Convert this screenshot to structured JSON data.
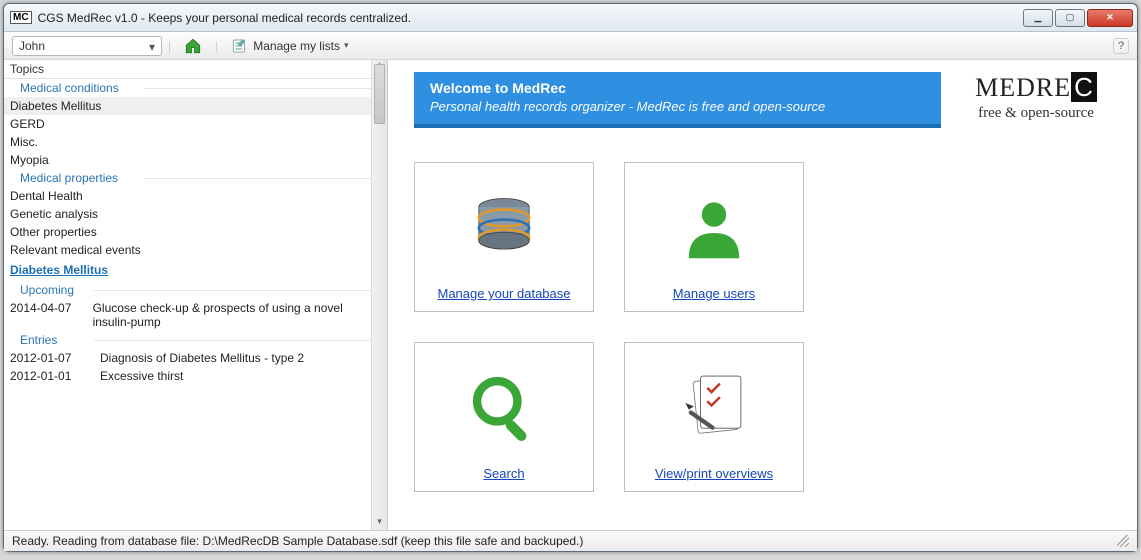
{
  "window": {
    "title": "CGS MedRec v1.0 - Keeps your personal medical records centralized."
  },
  "toolbar": {
    "user_selected": "John",
    "manage_lists_label": "Manage my lists"
  },
  "sidebar": {
    "topics_header": "Topics",
    "conditions_header": "Medical conditions",
    "conditions": [
      "Diabetes Mellitus",
      "GERD",
      "Misc.",
      "Myopia"
    ],
    "properties_header": "Medical properties",
    "properties": [
      "Dental Health",
      "Genetic analysis",
      "Other properties",
      "Relevant medical events"
    ],
    "selected_topic": "Diabetes Mellitus",
    "upcoming_header": "Upcoming",
    "upcoming": [
      {
        "date": "2014-04-07",
        "text": "Glucose check-up & prospects of using a novel insulin-pump"
      }
    ],
    "entries_header": "Entries",
    "entries": [
      {
        "date": "2012-01-07",
        "text": "Diagnosis of Diabetes Mellitus - type 2"
      },
      {
        "date": "2012-01-01",
        "text": "Excessive thirst"
      }
    ]
  },
  "main": {
    "welcome_title": "Welcome to MedRec",
    "welcome_sub": "Personal health records organizer - MedRec is free and open-source",
    "logo_text": "MEDREC",
    "logo_tag": "free & open-source",
    "tiles": {
      "db": "Manage your database",
      "users": "Manage users",
      "search": "Search",
      "overviews": "View/print overviews"
    }
  },
  "statusbar": {
    "text": "Ready. Reading from database file: D:\\MedRecDB Sample Database.sdf (keep this file safe and backuped.)"
  }
}
